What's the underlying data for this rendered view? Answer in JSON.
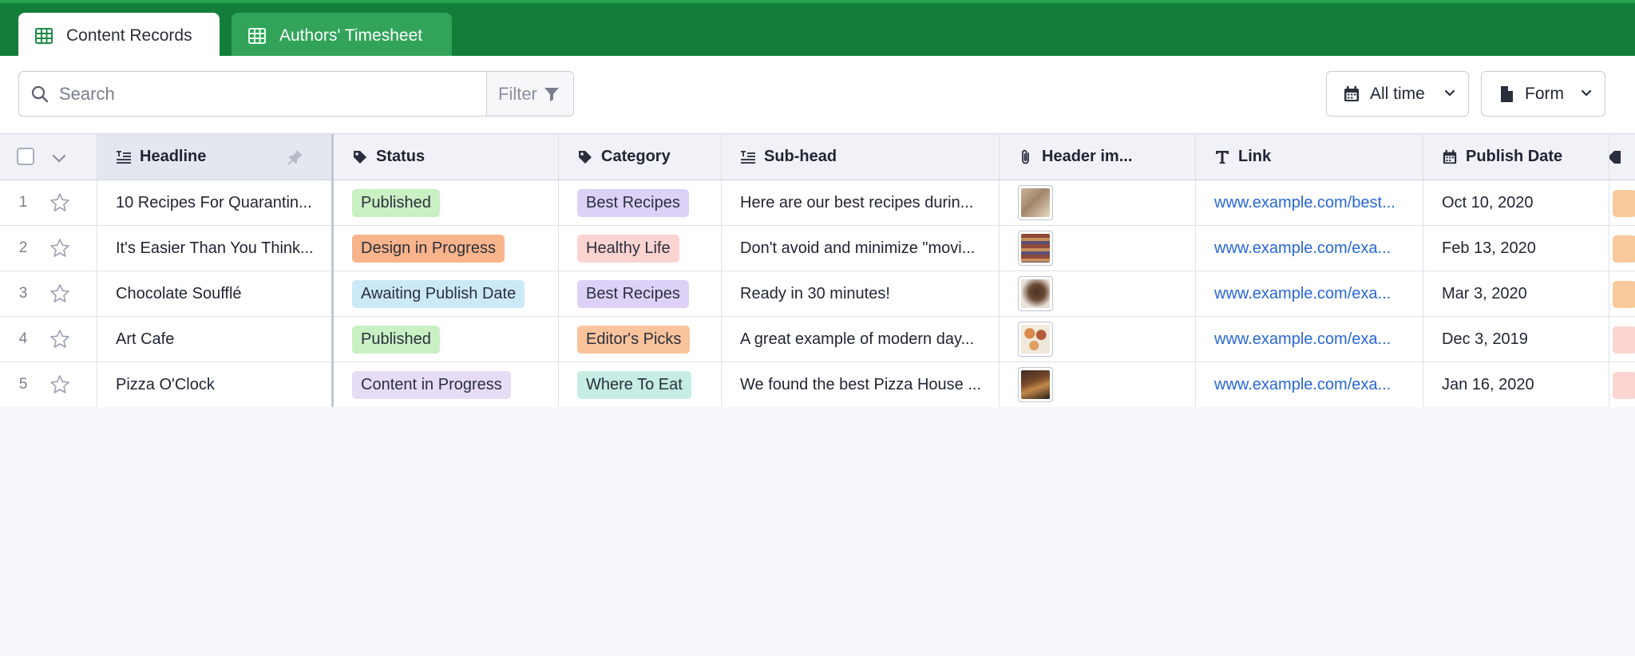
{
  "tabs": [
    {
      "label": "Content Records",
      "active": true
    },
    {
      "label": "Authors' Timesheet",
      "active": false
    }
  ],
  "toolbar": {
    "search_placeholder": "Search",
    "filter_label": "Filter",
    "time_label": "All time",
    "form_label": "Form"
  },
  "columns": {
    "headline": "Headline",
    "status": "Status",
    "category": "Category",
    "subhead": "Sub-head",
    "header_image": "Header im...",
    "link": "Link",
    "publish_date": "Publish Date"
  },
  "rows": [
    {
      "num": "1",
      "headline": "10 Recipes For Quarantin...",
      "status": "Published",
      "status_color": "#c9f0c3",
      "category": "Best Recipes",
      "category_color": "#ddd1f7",
      "subhead": "Here are our best recipes durin...",
      "image": "cat",
      "link": "www.example.com/best...",
      "date": "Oct 10, 2020",
      "edge_color": "#f8c99a"
    },
    {
      "num": "2",
      "headline": "It's Easier Than You Think...",
      "status": "Design in Progress",
      "status_color": "#f9b48b",
      "category": "Healthy Life",
      "category_color": "#fbd3d1",
      "subhead": "Don't avoid and minimize \"movi...",
      "image": "books",
      "link": "www.example.com/exa...",
      "date": "Feb 13, 2020",
      "edge_color": "#f8c99a"
    },
    {
      "num": "3",
      "headline": "Chocolate Soufflé",
      "status": "Awaiting Publish Date",
      "status_color": "#cbe9f7",
      "category": "Best Recipes",
      "category_color": "#ddd1f7",
      "subhead": "Ready in 30 minutes!",
      "image": "dessert",
      "link": "www.example.com/exa...",
      "date": "Mar 3, 2020",
      "edge_color": "#f8c99a"
    },
    {
      "num": "4",
      "headline": "Art Cafe",
      "status": "Published",
      "status_color": "#c9f0c3",
      "category": "Editor's Picks",
      "category_color": "#f9c39b",
      "subhead": "A great example of modern day...",
      "image": "donuts",
      "link": "www.example.com/exa...",
      "date": "Dec 3, 2019",
      "edge_color": "#fbd3d1"
    },
    {
      "num": "5",
      "headline": "Pizza O'Clock",
      "status": "Content in Progress",
      "status_color": "#e6dcf6",
      "category": "Where To Eat",
      "category_color": "#c5ede3",
      "subhead": "We found the best Pizza House ...",
      "image": "pizza",
      "link": "www.example.com/exa...",
      "date": "Jan 16, 2020",
      "edge_color": "#fbd3d1"
    }
  ],
  "colors": {
    "topbar": "#137d3a",
    "tab_inactive": "#31a45a",
    "link": "#2767d6"
  }
}
